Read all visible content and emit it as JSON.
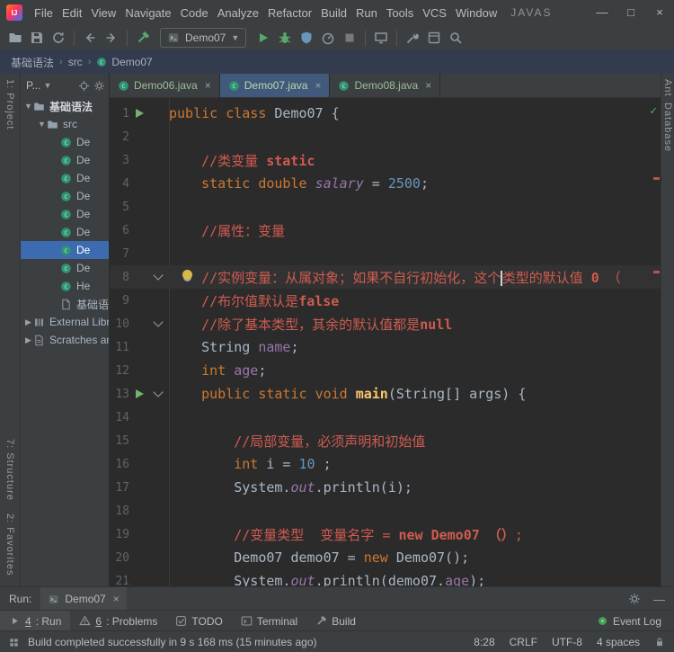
{
  "window": {
    "title": "JAVAS",
    "menus": [
      "File",
      "Edit",
      "View",
      "Navigate",
      "Code",
      "Analyze",
      "Refactor",
      "Build",
      "Run",
      "Tools",
      "VCS",
      "Window"
    ],
    "controls": {
      "minimize": "—",
      "maximize": "□",
      "close": "×"
    }
  },
  "toolbar": {
    "run_config": "Demo07"
  },
  "breadcrumbs": {
    "items": [
      "基础语法",
      "src",
      "Demo07"
    ],
    "separator": "›"
  },
  "project": {
    "header": "P...",
    "items": [
      {
        "label": "基础语法",
        "icon": "folder",
        "indent": 0,
        "arrow": "expanded",
        "bold": true
      },
      {
        "label": "src",
        "icon": "folder",
        "indent": 1,
        "arrow": "expanded"
      },
      {
        "label": "De",
        "icon": "class",
        "indent": 2
      },
      {
        "label": "De",
        "icon": "class",
        "indent": 2
      },
      {
        "label": "De",
        "icon": "class",
        "indent": 2
      },
      {
        "label": "De",
        "icon": "class",
        "indent": 2
      },
      {
        "label": "De",
        "icon": "class",
        "indent": 2
      },
      {
        "label": "De",
        "icon": "class",
        "indent": 2
      },
      {
        "label": "De",
        "icon": "class",
        "indent": 2,
        "selected": true
      },
      {
        "label": "De",
        "icon": "class",
        "indent": 2
      },
      {
        "label": "He",
        "icon": "class",
        "indent": 2
      },
      {
        "label": "基础语",
        "icon": "file",
        "indent": 2
      },
      {
        "label": "External Libraries",
        "icon": "lib",
        "indent": 0,
        "arrow": "collapsed"
      },
      {
        "label": "Scratches and Consoles",
        "icon": "scratch",
        "indent": 0,
        "arrow": "collapsed"
      }
    ]
  },
  "tabs": {
    "items": [
      {
        "label": "Demo06.java",
        "close": "×"
      },
      {
        "label": "Demo07.java",
        "close": "×",
        "active": true
      },
      {
        "label": "Demo08.java",
        "close": "×"
      }
    ]
  },
  "editor": {
    "inspection_status": "✓",
    "lines": [
      {
        "n": 1,
        "run": true,
        "segs": [
          [
            "k",
            "public"
          ],
          [
            "p",
            " "
          ],
          [
            "k",
            "class"
          ],
          [
            "p",
            " Demo07 {"
          ]
        ]
      },
      {
        "n": 2,
        "segs": []
      },
      {
        "n": 3,
        "segs": [
          [
            "p",
            "    "
          ],
          [
            "c",
            "//类变量 "
          ],
          [
            "cb",
            "static"
          ]
        ]
      },
      {
        "n": 4,
        "segs": [
          [
            "p",
            "    "
          ],
          [
            "k",
            "static"
          ],
          [
            "p",
            " "
          ],
          [
            "k",
            "double"
          ],
          [
            "p",
            " "
          ],
          [
            "fi",
            "salary"
          ],
          [
            "p",
            " = "
          ],
          [
            "n2",
            "2500"
          ],
          [
            "p",
            ";"
          ]
        ]
      },
      {
        "n": 5,
        "segs": []
      },
      {
        "n": 6,
        "segs": [
          [
            "p",
            "    "
          ],
          [
            "c",
            "//属性：变量"
          ]
        ]
      },
      {
        "n": 7,
        "segs": []
      },
      {
        "n": 8,
        "current": true,
        "fold": true,
        "bulb": true,
        "segs": [
          [
            "p",
            "    "
          ],
          [
            "c",
            "//实例变量：从属对象；如果不自行初始化，这个"
          ],
          [
            "caret",
            ""
          ],
          [
            "c",
            "类型的默认值 "
          ],
          [
            "cb",
            "0"
          ],
          [
            "c",
            " （"
          ]
        ]
      },
      {
        "n": 9,
        "segs": [
          [
            "p",
            "    "
          ],
          [
            "c",
            "//布尔值默认是"
          ],
          [
            "cb",
            "false"
          ]
        ]
      },
      {
        "n": 10,
        "fold": true,
        "segs": [
          [
            "p",
            "    "
          ],
          [
            "c",
            "//除了基本类型，其余的默认值都是"
          ],
          [
            "cb",
            "null"
          ]
        ]
      },
      {
        "n": 11,
        "segs": [
          [
            "p",
            "    String "
          ],
          [
            "f",
            "name"
          ],
          [
            "p",
            ";"
          ]
        ]
      },
      {
        "n": 12,
        "segs": [
          [
            "p",
            "    "
          ],
          [
            "k",
            "int"
          ],
          [
            "p",
            " "
          ],
          [
            "f",
            "age"
          ],
          [
            "p",
            ";"
          ]
        ]
      },
      {
        "n": 13,
        "run": true,
        "fold": true,
        "segs": [
          [
            "p",
            "    "
          ],
          [
            "k",
            "public"
          ],
          [
            "p",
            " "
          ],
          [
            "k",
            "static"
          ],
          [
            "p",
            " "
          ],
          [
            "k",
            "void"
          ],
          [
            "p",
            " "
          ],
          [
            "m",
            "main"
          ],
          [
            "p",
            "(String[] args) {"
          ]
        ]
      },
      {
        "n": 14,
        "segs": []
      },
      {
        "n": 15,
        "segs": [
          [
            "p",
            "        "
          ],
          [
            "c",
            "//局部变量，必须声明和初始值"
          ]
        ]
      },
      {
        "n": 16,
        "segs": [
          [
            "p",
            "        "
          ],
          [
            "k",
            "int"
          ],
          [
            "p",
            " i = "
          ],
          [
            "n2",
            "10"
          ],
          [
            "p",
            " ;"
          ]
        ]
      },
      {
        "n": 17,
        "segs": [
          [
            "p",
            "        System."
          ],
          [
            "fi",
            "out"
          ],
          [
            "p",
            ".println(i);"
          ]
        ]
      },
      {
        "n": 18,
        "segs": []
      },
      {
        "n": 19,
        "segs": [
          [
            "p",
            "        "
          ],
          [
            "c",
            "//变量类型  变量名字 = "
          ],
          [
            "cb",
            "new Demo07 （）"
          ],
          [
            "c",
            ";"
          ]
        ]
      },
      {
        "n": 20,
        "segs": [
          [
            "p",
            "        Demo07 demo07 = "
          ],
          [
            "k",
            "new"
          ],
          [
            "p",
            " Demo07();"
          ]
        ]
      },
      {
        "n": 21,
        "segs": [
          [
            "p",
            "        System."
          ],
          [
            "fi",
            "out"
          ],
          [
            "p",
            ".println(demo07."
          ],
          [
            "f",
            "age"
          ],
          [
            "p",
            ");"
          ]
        ]
      }
    ]
  },
  "run_panel": {
    "label": "Run:",
    "tab": "Demo07",
    "close": "×"
  },
  "bottom_bar": {
    "left": [
      {
        "icon": "play",
        "hotkey": "4",
        "label": ": Run",
        "active": true
      },
      {
        "icon": "problems",
        "hotkey": "6",
        "label": ": Problems"
      },
      {
        "icon": "todo",
        "label": "TODO"
      },
      {
        "icon": "terminal",
        "label": "Terminal"
      },
      {
        "icon": "build",
        "label": "Build"
      }
    ],
    "right": [
      {
        "icon": "event",
        "label": "Event Log"
      }
    ]
  },
  "status_bar": {
    "message": "Build completed successfully in 9 s 168 ms (15 minutes ago)",
    "items": [
      "8:28",
      "CRLF",
      "UTF-8",
      "4 spaces"
    ]
  },
  "stripes": {
    "left_top": [
      "1: Project"
    ],
    "left_bottom": [
      "7: Structure",
      "2: Favorites"
    ],
    "right": [
      "Ant",
      "Database"
    ]
  }
}
